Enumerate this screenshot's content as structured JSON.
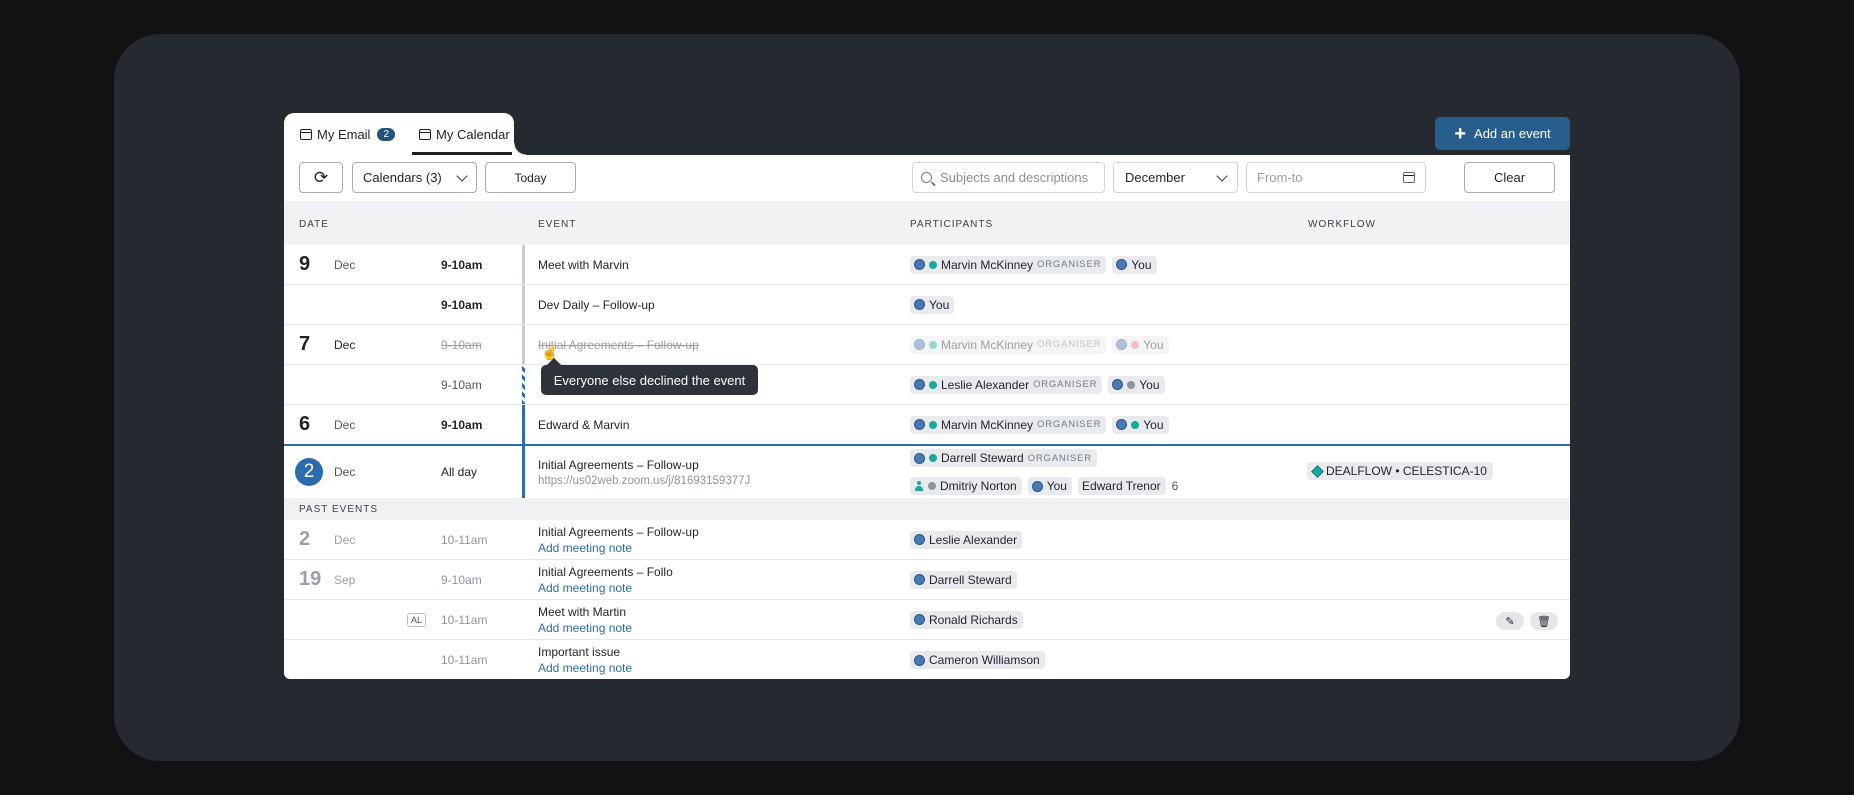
{
  "tabs": [
    {
      "label": "My Email",
      "badge": "2",
      "icon": "inbox-icon"
    },
    {
      "label": "My Calendar",
      "icon": "calendar-icon"
    }
  ],
  "toolbar": {
    "refresh_icon": "refresh-icon",
    "calendars_label": "Calendars (3)",
    "today_label": "Today",
    "search_placeholder": "Subjects and descriptions",
    "month_value": "December",
    "fromto_placeholder": "From-to",
    "clear_label": "Clear",
    "add_label": "Add an event"
  },
  "headers": {
    "date": "DATE",
    "event": "EVENT",
    "participants": "PARTICIPANTS",
    "workflow": "WORKFLOW"
  },
  "tooltip": "Everyone else declined the event",
  "section_past": "PAST EVENTS",
  "upcoming": [
    {
      "day": "9",
      "month": "Dec",
      "time": "9-10am",
      "event": "Meet with Marvin",
      "participants": [
        {
          "name": "Marvin McKinney",
          "role": "ORGANISER",
          "status": "accepted"
        },
        {
          "name": "You",
          "status": "none"
        }
      ]
    },
    {
      "day": "",
      "month": "",
      "time": "9-10am",
      "event": "Dev Daily – Follow-up",
      "participants": [
        {
          "name": "You",
          "status": "none"
        }
      ]
    },
    {
      "day": "7",
      "month": "Dec",
      "time": "9-10am",
      "event": "Initial Agreements – Follow-up",
      "declined": true,
      "participants": [
        {
          "name": "Marvin McKinney",
          "role": "ORGANISER",
          "status": "accepted"
        },
        {
          "name": "You",
          "status": "declined"
        }
      ]
    },
    {
      "day": "",
      "month": "",
      "time": "9-10am",
      "event": "",
      "participants": [
        {
          "name": "Leslie Alexander",
          "role": "ORGANISER",
          "status": "accepted"
        },
        {
          "name": "You",
          "status": "tentative"
        }
      ]
    },
    {
      "day": "6",
      "month": "Dec",
      "time": "9-10am",
      "event": "Edward & Marvin",
      "participants": [
        {
          "name": "Marvin McKinney",
          "role": "ORGANISER",
          "status": "accepted"
        },
        {
          "name": "You",
          "status": "accepted"
        }
      ]
    },
    {
      "day": "2",
      "month": "Dec",
      "time": "All day",
      "event": "Initial Agreements – Follow-up",
      "link": "https://us02web.zoom.us/j/81693159377J",
      "participants": [
        {
          "name": "Darrell Steward",
          "role": "ORGANISER",
          "status": "accepted"
        },
        {
          "name": "Dmitriy Norton",
          "status": "tentative"
        },
        {
          "name": "You",
          "status": "none"
        },
        {
          "name": "Edward Trenor"
        }
      ],
      "more": "6",
      "workflow": "DEALFLOW • CELESTICA-10"
    }
  ],
  "past": [
    {
      "day": "2",
      "month": "Dec",
      "time": "10-11am",
      "event": "Initial Agreements – Follow-up",
      "note": "Add meeting note",
      "participant": "Leslie Alexander"
    },
    {
      "day": "19",
      "month": "Sep",
      "time": "9-10am",
      "event": "Initial Agreements – Follo",
      "note": "Add meeting note",
      "participant": "Darrell Steward"
    },
    {
      "day": "",
      "month": "",
      "tag": "AL",
      "time": "10-11am",
      "event": "Meet with Martin",
      "note": "Add meeting note",
      "participant": "Ronald Richards"
    },
    {
      "day": "",
      "month": "",
      "time": "10-11am",
      "event": "Important issue",
      "note": "Add meeting note",
      "participant": "Cameron Williamson"
    }
  ],
  "actions": {
    "edit_icon": "pencil-icon",
    "delete_icon": "trash-icon"
  }
}
